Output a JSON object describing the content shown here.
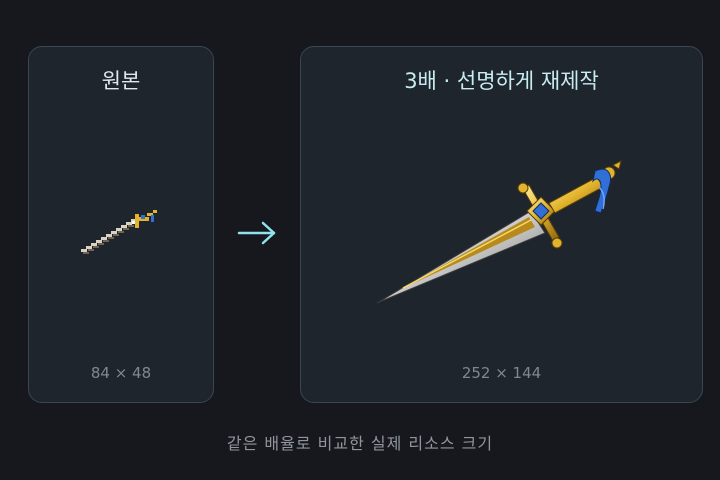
{
  "original": {
    "title": "원본",
    "dims": "84 × 48"
  },
  "upscaled": {
    "title": "3배 · 선명하게 재제작",
    "dims": "252 × 144"
  },
  "arrow_icon": "arrow-right-icon",
  "caption": "같은 배율로 비교한 실제 리소스 크기",
  "colors": {
    "background": "#16181d",
    "panel": "#1f252c",
    "panel_border": "#3a4652",
    "arrow": "#8fe3ee",
    "gold": "#e2b42c",
    "gem": "#2f6fd6"
  }
}
